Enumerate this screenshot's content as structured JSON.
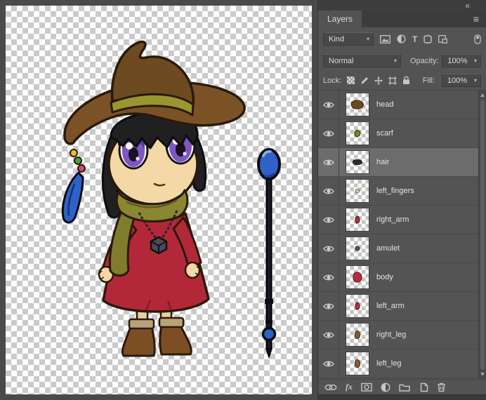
{
  "titlebar": {
    "collapse_glyph": "«",
    "menu_glyph": "≡"
  },
  "panel": {
    "tab_label": "Layers",
    "filter": {
      "kind_label": "Kind",
      "type_glyph": "T",
      "dropdown_glyph": "▾"
    },
    "blend": {
      "mode_value": "Normal",
      "opacity_label": "Opacity:",
      "opacity_value": "100%"
    },
    "lock": {
      "label": "Lock:",
      "fill_label": "Fill:",
      "fill_value": "100%"
    },
    "layers": [
      {
        "name": "head",
        "visible": true,
        "selected": false,
        "thumb": {
          "color": "#6b4a1f",
          "w": 18,
          "h": 13
        }
      },
      {
        "name": "scarf",
        "visible": true,
        "selected": false,
        "thumb": {
          "color": "#7c7b2a",
          "w": 9,
          "h": 10
        }
      },
      {
        "name": "hair",
        "visible": true,
        "selected": true,
        "thumb": {
          "color": "#2e2e30",
          "w": 14,
          "h": 8
        }
      },
      {
        "name": "left_fingers",
        "visible": true,
        "selected": false,
        "thumb": {
          "color": "#e9cf9f",
          "w": 6,
          "h": 6
        }
      },
      {
        "name": "right_arm",
        "visible": true,
        "selected": false,
        "thumb": {
          "color": "#b22f3c",
          "w": 7,
          "h": 11
        }
      },
      {
        "name": "amulet",
        "visible": true,
        "selected": false,
        "thumb": {
          "color": "#55555e",
          "w": 7,
          "h": 7
        }
      },
      {
        "name": "body",
        "visible": true,
        "selected": false,
        "thumb": {
          "color": "#b22f3c",
          "w": 13,
          "h": 15
        }
      },
      {
        "name": "left_arm",
        "visible": true,
        "selected": false,
        "thumb": {
          "color": "#b22f3c",
          "w": 7,
          "h": 11
        }
      },
      {
        "name": "right_leg",
        "visible": true,
        "selected": false,
        "thumb": {
          "color": "#8a5a2e",
          "w": 8,
          "h": 12
        }
      },
      {
        "name": "left_leg",
        "visible": true,
        "selected": false,
        "thumb": {
          "color": "#8a5a2e",
          "w": 8,
          "h": 12
        }
      }
    ],
    "footer": {
      "fx_label": "fx"
    }
  },
  "colors": {
    "panel_bg": "#535353",
    "selected_row": "#6c6c6c",
    "canvas_check_light": "#ffffff",
    "canvas_check_dark": "#cacaca",
    "staff_blue": "#2e62c8",
    "dress_red": "#b32839",
    "hat_brown": "#7a5226",
    "scarf_olive": "#8b8730",
    "eye_purple": "#7e57c2"
  }
}
